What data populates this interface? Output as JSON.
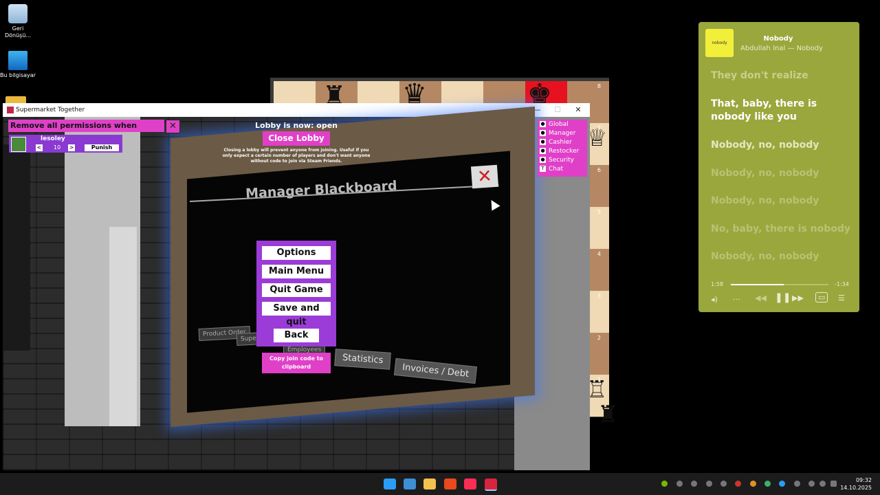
{
  "desktop": {
    "icons": [
      {
        "label": "Geri Dönüşü...",
        "icon": "recycle-bin-icon"
      },
      {
        "label": "Bu bilgisayar",
        "icon": "monitor-icon"
      }
    ]
  },
  "chess": {
    "ranks": [
      "8",
      "7",
      "6",
      "5",
      "4",
      "3",
      "2",
      "1"
    ],
    "pieces": [
      {
        "glyph": "♜",
        "name": "black-rook-icon"
      },
      {
        "glyph": "♛",
        "name": "black-queen-icon"
      },
      {
        "glyph": "♚",
        "name": "black-king-icon"
      },
      {
        "glyph": "♕",
        "name": "white-queen-icon"
      },
      {
        "glyph": "♖",
        "name": "white-rook-icon"
      }
    ],
    "colors": {
      "light": "#f0d9b5",
      "dark": "#b58863",
      "check": "#e8111f"
    }
  },
  "game_window": {
    "title": "Supermarket Together",
    "controls": {
      "minimize": "—",
      "maximize": "☐",
      "close": "✕"
    }
  },
  "overlay": {
    "remove_permissions": "Remove all permissions when joining",
    "lobby_status": "Lobby is now: open",
    "close_lobby": "Close Lobby",
    "lobby_note": "Closing a lobby will prevent anyone from joining. Useful if you only expect a certain number of players and don't want anyone without code to join via Steam Friends.",
    "player": {
      "name": "lesoley",
      "value": "10",
      "punish": "Punish",
      "dec": "<",
      "inc": ">"
    },
    "permissions": [
      {
        "label": "Global",
        "icon": "globe-icon"
      },
      {
        "label": "Manager",
        "icon": "person-icon"
      },
      {
        "label": "Cashier",
        "icon": "coin-icon"
      },
      {
        "label": "Restocker",
        "icon": "box-icon"
      },
      {
        "label": "Security",
        "icon": "shield-icon"
      },
      {
        "label": "Chat",
        "icon": "chat-icon"
      }
    ]
  },
  "blackboard": {
    "title": "Manager Blackboard",
    "tabs": [
      "Product Order",
      "Super",
      "Employees",
      "Statistics",
      "Invoices / Debt"
    ]
  },
  "pause_menu": {
    "options": "Options",
    "main_menu": "Main Menu",
    "quit_game": "Quit Game",
    "save_quit": "Save and quit",
    "back": "Back",
    "copy_code": "Copy join code to clipboard"
  },
  "music": {
    "art_label": "nobody",
    "title": "Nobody",
    "artist": "Abdullah İnal — Nobody",
    "lyrics": [
      "They don't realize",
      "That, baby, there is nobody like you",
      "Nobody, no, nobody",
      "Nobody, no, nobody",
      "Nobody, no, nobody",
      "No, baby, there is nobody",
      "Nobody, no, nobody"
    ],
    "elapsed": "1:58",
    "remaining": "-1:34",
    "progress": 0.54,
    "bg_color": "#9aa73d"
  },
  "taskbar": {
    "apps": [
      {
        "name": "start-icon",
        "color": "#2a9df4"
      },
      {
        "name": "widgets-icon",
        "color": "#3d8fd6"
      },
      {
        "name": "file-explorer-icon",
        "color": "#f2c14e"
      },
      {
        "name": "brave-icon",
        "color": "#e8491d"
      },
      {
        "name": "music-app-icon",
        "color": "#fa2d55"
      },
      {
        "name": "supermarket-together-icon",
        "color": "#d8243f"
      }
    ],
    "time": "09:32",
    "date": "14.10.2025"
  }
}
